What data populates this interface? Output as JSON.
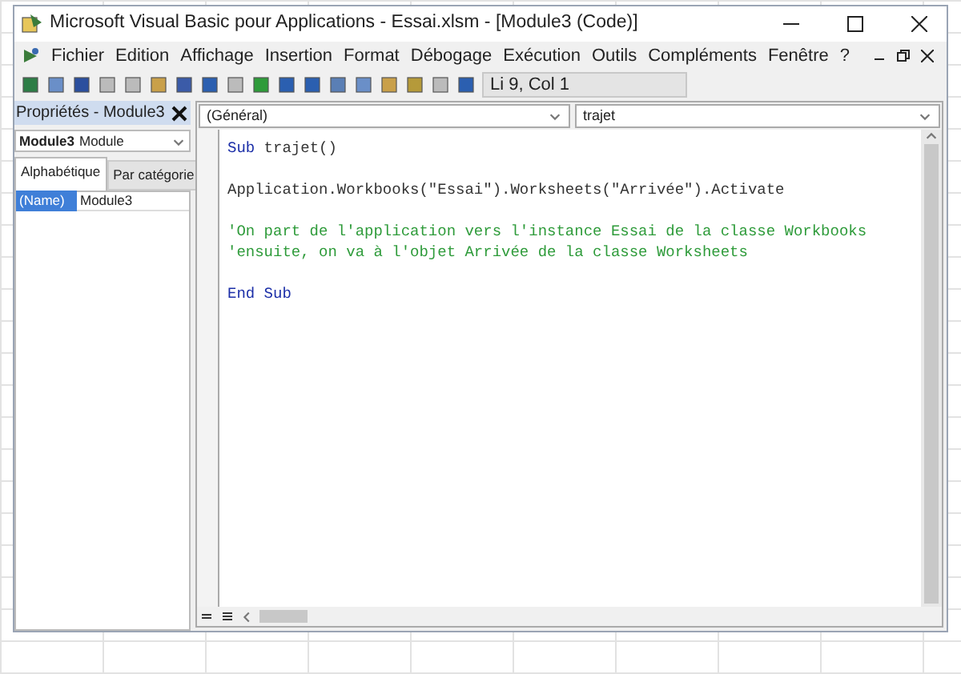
{
  "window": {
    "title": "Microsoft Visual Basic pour Applications - Essai.xlsm - [Module3 (Code)]"
  },
  "menu": [
    "Fichier",
    "Edition",
    "Affichage",
    "Insertion",
    "Format",
    "Débogage",
    "Exécution",
    "Outils",
    "Compléments",
    "Fenêtre",
    "?"
  ],
  "toolbar": {
    "position": "Li 9, Col 1"
  },
  "properties": {
    "title": "Propriétés - Module3",
    "object": {
      "name": "Module3",
      "type": "Module"
    },
    "tabs": [
      {
        "label": "Alphabétique",
        "selected": true
      },
      {
        "label": "Par catégorie",
        "selected": false
      }
    ],
    "rows": [
      {
        "name": "(Name)",
        "value": "Module3",
        "selected": true
      }
    ]
  },
  "code": {
    "object_dropdown": "(Général)",
    "procedure_dropdown": "trajet",
    "lines": [
      {
        "kind": "code",
        "segments": [
          {
            "text": "Sub",
            "kind": "keyword"
          },
          {
            "text": " trajet()",
            "kind": "plain"
          }
        ]
      },
      {
        "kind": "blank"
      },
      {
        "kind": "code",
        "segments": [
          {
            "text": "Application.Workbooks(\"Essai\").Worksheets(\"Arrivée\").Activate",
            "kind": "plain"
          }
        ]
      },
      {
        "kind": "blank"
      },
      {
        "kind": "code",
        "segments": [
          {
            "text": "'On part de l'application vers l'instance Essai de la classe Workbooks",
            "kind": "comment"
          }
        ]
      },
      {
        "kind": "code",
        "segments": [
          {
            "text": "'ensuite, on va à l'objet Arrivée de la classe Worksheets",
            "kind": "comment"
          }
        ]
      },
      {
        "kind": "blank"
      },
      {
        "kind": "code",
        "segments": [
          {
            "text": "End Sub",
            "kind": "keyword"
          }
        ]
      }
    ]
  }
}
